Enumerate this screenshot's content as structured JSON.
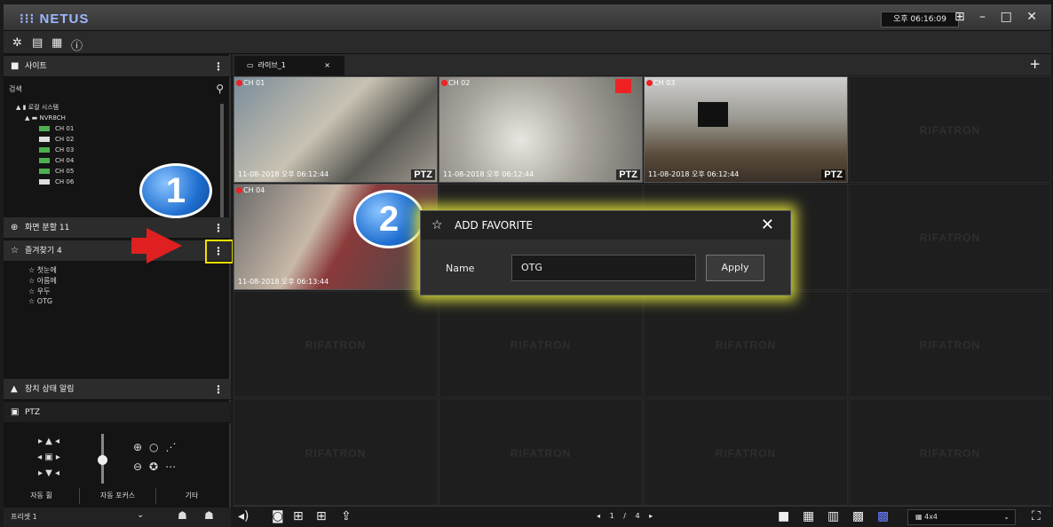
{
  "app": {
    "title": "NETUS",
    "clock": "오후 06:16:09",
    "window_controls": "⊞ – □ ✕"
  },
  "toolbar": {
    "icons": [
      "gear-icon",
      "calendar-icon",
      "list-icon",
      "info-icon"
    ]
  },
  "sidebar": {
    "site_label": "사이트",
    "search_label": "검색",
    "tree": {
      "root": "로컬 시스템",
      "nvr": "NVR8CH",
      "channels": [
        "CH 01",
        "CH 02",
        "CH 03",
        "CH 04",
        "CH 05",
        "CH 06"
      ]
    },
    "screen_split_label": "화면 분할 11",
    "favorites_label": "즐겨찾기 4",
    "favorites": [
      "첫눈에",
      "아름에",
      "우두",
      "OTG"
    ],
    "alarm_label": "장치 상태 알림",
    "ptz_label": "PTZ",
    "buttons": [
      "자동 휠",
      "자동 포커스",
      "기타"
    ],
    "preset": "프리셋 1"
  },
  "main": {
    "tab_label": "라이브_1",
    "tab_close": "×",
    "add": "+",
    "watermark": "RIFATRON",
    "cameras": [
      {
        "label": "CH 01",
        "timestamp": "11-08-2018 오후 06:12:44",
        "ptz": "PTZ"
      },
      {
        "label": "CH 02",
        "timestamp": "11-08-2018 오후 06:12:44",
        "ptz": "PTZ"
      },
      {
        "label": "CH 03",
        "timestamp": "11-08-2018 오후 06:12:44",
        "ptz": "PTZ"
      },
      {
        "label": "CH 04",
        "timestamp": "11-08-2018 오후 06:13:44",
        "ptz": ""
      }
    ],
    "paging": {
      "current": "1",
      "sep": "/",
      "total": "4"
    },
    "layout": "4x4"
  },
  "dialog": {
    "title": "ADD FAVORITE",
    "name_label": "Name",
    "name_value": "OTG",
    "apply_label": "Apply",
    "close": "✕"
  },
  "callouts": [
    "1",
    "2"
  ]
}
